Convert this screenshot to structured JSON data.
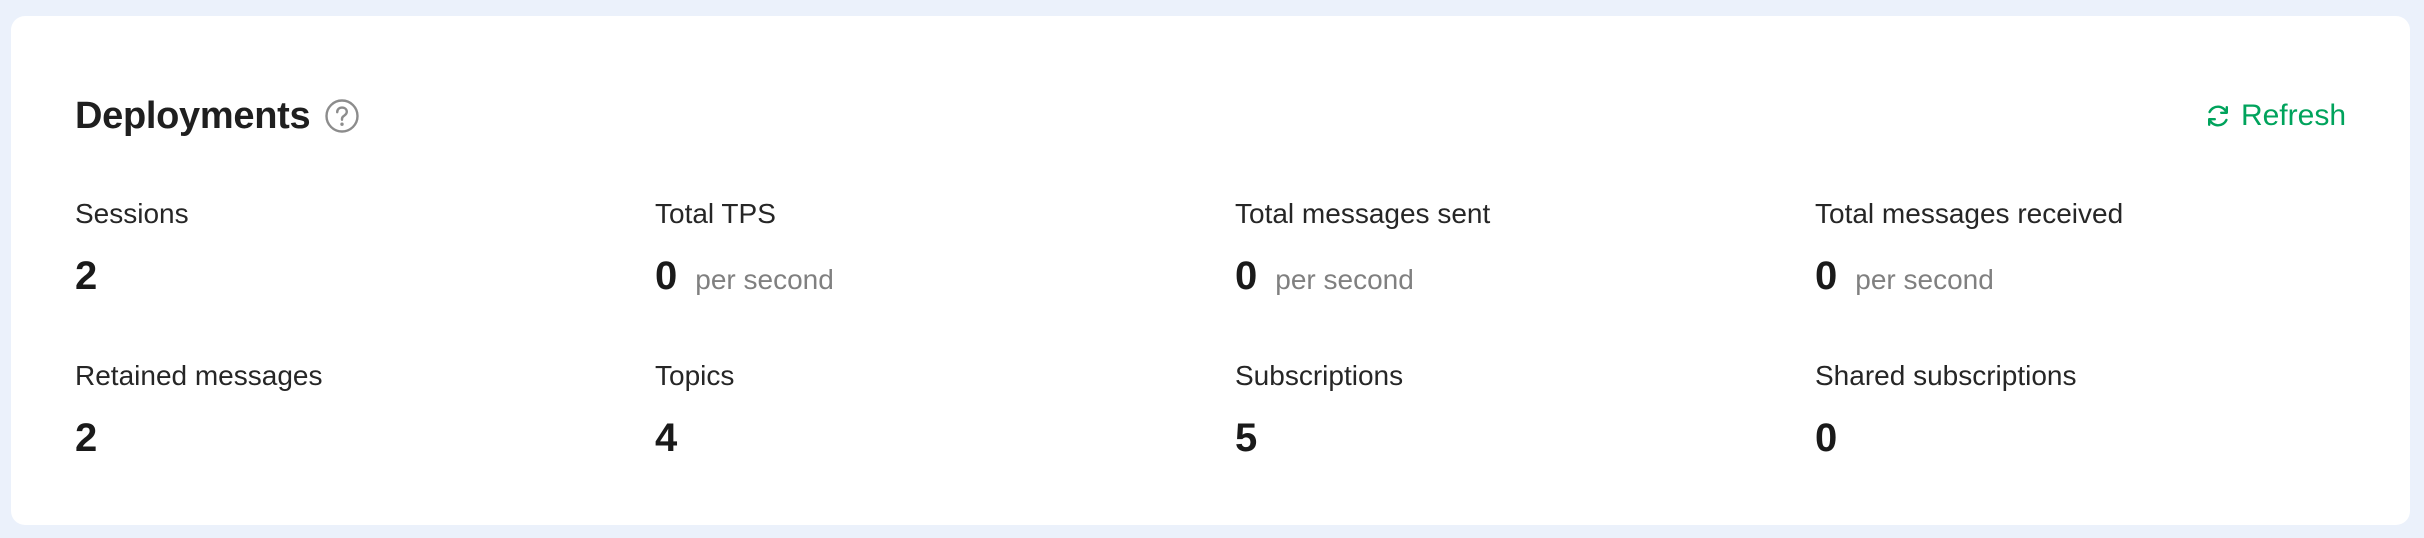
{
  "header": {
    "title": "Deployments",
    "help_icon": "question-circle-icon",
    "refresh_label": "Refresh",
    "refresh_icon": "refresh-icon"
  },
  "colors": {
    "accent": "#00a35c",
    "page_bg": "#ebf1fb",
    "card_bg": "#ffffff"
  },
  "stats": [
    {
      "label": "Sessions",
      "value": "2",
      "unit": ""
    },
    {
      "label": "Total TPS",
      "value": "0",
      "unit": "per second"
    },
    {
      "label": "Total messages sent",
      "value": "0",
      "unit": "per second"
    },
    {
      "label": "Total messages received",
      "value": "0",
      "unit": "per second"
    },
    {
      "label": "Retained messages",
      "value": "2",
      "unit": ""
    },
    {
      "label": "Topics",
      "value": "4",
      "unit": ""
    },
    {
      "label": "Subscriptions",
      "value": "5",
      "unit": ""
    },
    {
      "label": "Shared subscriptions",
      "value": "0",
      "unit": ""
    }
  ]
}
